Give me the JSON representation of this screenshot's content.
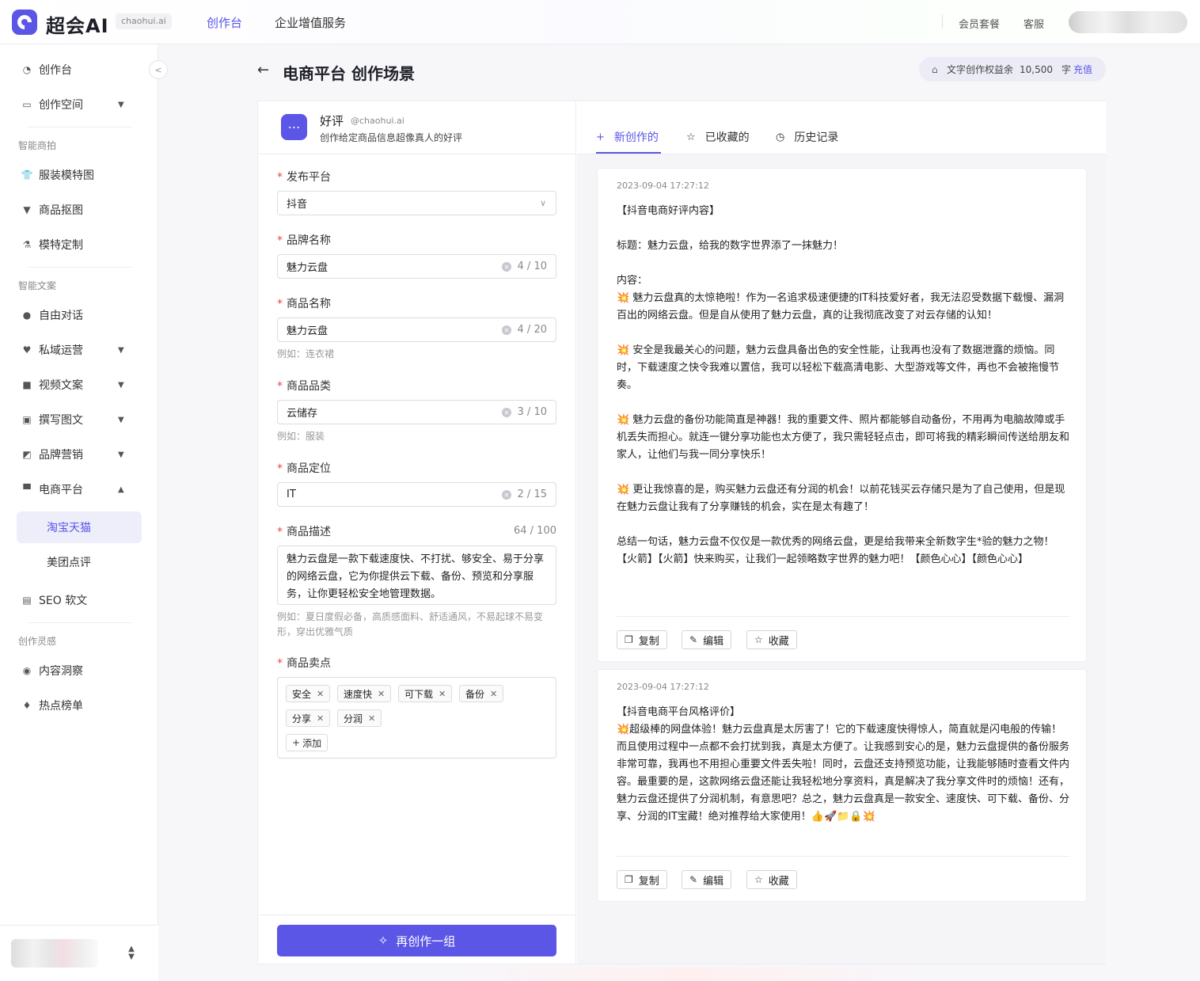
{
  "header": {
    "brand": "超会AI",
    "domain": "chaohui.ai",
    "nav": [
      "创作台",
      "企业增值服务"
    ],
    "links": [
      "会员套餐",
      "客服"
    ]
  },
  "sidebar": {
    "items": {
      "workbench": "创作台",
      "space": "创作空间",
      "group_merch": "智能商拍",
      "clothing_model": "服装模特图",
      "cutout": "商品抠图",
      "model_custom": "模特定制",
      "group_copy": "智能文案",
      "chat": "自由对话",
      "private": "私域运营",
      "video": "视频文案",
      "article": "撰写图文",
      "brand": "品牌营销",
      "ecommerce": "电商平台",
      "taobao": "淘宝天猫",
      "meituan": "美团点评",
      "seo": "SEO 软文",
      "group_insp": "创作灵感",
      "insight": "内容洞察",
      "hot": "热点榜单"
    }
  },
  "page": {
    "title": "电商平台 创作场景",
    "quota_label": "文字创作权益余",
    "quota_value": "10,500",
    "quota_unit": "字",
    "recharge": "充值"
  },
  "tool": {
    "name": "好评",
    "handle": "@chaohui.ai",
    "desc": "创作给定商品信息超像真人的好评"
  },
  "form": {
    "platform": {
      "label": "发布平台",
      "value": "抖音"
    },
    "brand": {
      "label": "品牌名称",
      "value": "魅力云盘",
      "count": "4 / 10"
    },
    "product": {
      "label": "商品名称",
      "value": "魅力云盘",
      "count": "4 / 20",
      "hint": "例如：连衣裙"
    },
    "category": {
      "label": "商品品类",
      "value": "云储存",
      "count": "3 / 10",
      "hint": "例如：服装"
    },
    "position": {
      "label": "商品定位",
      "value": "IT",
      "count": "2 / 15"
    },
    "description": {
      "label": "商品描述",
      "count": "64 / 100",
      "value": "魅力云盘是一款下载速度快、不打扰、够安全、易于分享的网络云盘，它为你提供云下载、备份、预览和分享服务，让你更轻松安全地管理数据。",
      "hint": "例如：夏日度假必备，高质感面料、舒适通风，不易起球不易变形，穿出优雅气质"
    },
    "selling_points": {
      "label": "商品卖点",
      "tags": [
        "安全",
        "速度快",
        "可下载",
        "备份",
        "分享",
        "分润"
      ],
      "add": "添加"
    },
    "submit": "再创作一组"
  },
  "tabs": [
    "新创作的",
    "已收藏的",
    "历史记录"
  ],
  "results": [
    {
      "time": "2023-09-04 17:27:12",
      "text": "【抖音电商好评内容】\n\n标题：魅力云盘，给我的数字世界添了一抹魅力！\n\n内容：\n💥 魅力云盘真的太惊艳啦！作为一名追求极速便捷的IT科技爱好者，我无法忍受数据下载慢、漏洞百出的网络云盘。但是自从使用了魅力云盘，真的让我彻底改变了对云存储的认知！\n\n💥 安全是我最关心的问题，魅力云盘具备出色的安全性能，让我再也没有了数据泄露的烦恼。同时，下载速度之快令我难以置信，我可以轻松下载高清电影、大型游戏等文件，再也不会被拖慢节奏。\n\n💥 魅力云盘的备份功能简直是神器！我的重要文件、照片都能够自动备份，不用再为电脑故障或手机丢失而担心。就连一键分享功能也太方便了，我只需轻轻点击，即可将我的精彩瞬间传送给朋友和家人，让他们与我一同分享快乐！\n\n💥 更让我惊喜的是，购买魅力云盘还有分润的机会！以前花钱买云存储只是为了自己使用，但是现在魅力云盘让我有了分享赚钱的机会，实在是太有趣了！\n\n总结一句话，魅力云盘不仅仅是一款优秀的网络云盘，更是给我带来全新数字生*验的魅力之物！【火箭】【火箭】快来购买，让我们一起领略数字世界的魅力吧！【颜色心心】【颜色心心】"
    },
    {
      "time": "2023-09-04 17:27:12",
      "text": "【抖音电商平台风格评价】\n💥超级棒的网盘体验！魅力云盘真是太厉害了！它的下载速度快得惊人，简直就是闪电般的传输！而且使用过程中一点都不会打扰到我，真是太方便了。让我感到安心的是，魅力云盘提供的备份服务非常可靠，我再也不用担心重要文件丢失啦！同时，云盘还支持预览功能，让我能够随时查看文件内容。最重要的是，这款网络云盘还能让我轻松地分享资料，真是解决了我分享文件时的烦恼！还有，魅力云盘还提供了分润机制，有意思吧？总之，魅力云盘真是一款安全、速度快、可下载、备份、分享、分润的IT宝藏！绝对推荐给大家使用！👍🚀📁🔒💥"
    }
  ],
  "actions": [
    "复制",
    "编辑",
    "收藏"
  ],
  "icons": {
    "logo": "logo-icon",
    "back": "arrow-left-icon",
    "quota": "gift-icon",
    "tool": "chat-bubble-icon",
    "new": "plus-icon",
    "star": "star-icon",
    "history": "clock-icon",
    "copy": "copy-icon",
    "edit": "pencil-icon",
    "magic": "magic-wand-icon"
  },
  "colors": {
    "accent": "#5b56e6",
    "required": "#e5484d"
  }
}
